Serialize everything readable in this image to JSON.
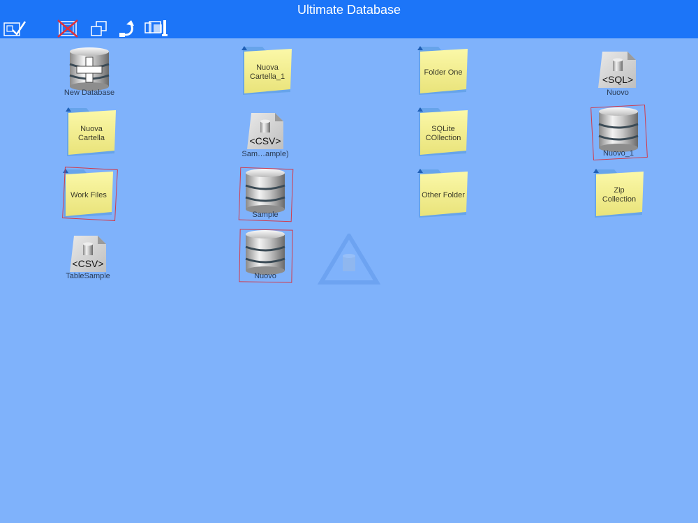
{
  "app": {
    "title": "Ultimate Database"
  },
  "toolbar": {
    "buttons": [
      {
        "name": "edit-selection-button",
        "icon": "select-check-icon"
      },
      {
        "name": "delete-button",
        "icon": "delete-x-icon"
      },
      {
        "name": "copy-button",
        "icon": "copy-icon"
      },
      {
        "name": "move-button",
        "icon": "move-arrow-icon"
      },
      {
        "name": "compress-button",
        "icon": "compress-icon"
      }
    ]
  },
  "grid": {
    "new_database": {
      "label": "New Database"
    },
    "nuova_cartella_1": {
      "label": "Nuova\nCartella_1"
    },
    "folder_one": {
      "label": "Folder One"
    },
    "sql_nuovo": {
      "label": "Nuovo",
      "badge": "<SQL>"
    },
    "nuova_cartella": {
      "label": "Nuova\nCartella"
    },
    "csv_sample": {
      "label": "Sam…ample)",
      "badge": "<CSV>"
    },
    "sqlite_collection": {
      "label": "SQLite\nCOllection"
    },
    "db_nuovo_1": {
      "label": "Nuovo_1"
    },
    "work_files": {
      "label": "Work Files"
    },
    "db_sample": {
      "label": "Sample"
    },
    "other_folder": {
      "label": "Other Folder"
    },
    "zip_collection": {
      "label": "Zip\nCollection"
    },
    "csv_tablesample": {
      "label": "TableSample",
      "badge": "<CSV>"
    },
    "db_nuovo": {
      "label": "Nuovo"
    }
  },
  "colors": {
    "background": "#7fb2fb",
    "topbar": "#1c75f8",
    "selection": "#d23a4a",
    "folder": "#f2ee8c"
  }
}
